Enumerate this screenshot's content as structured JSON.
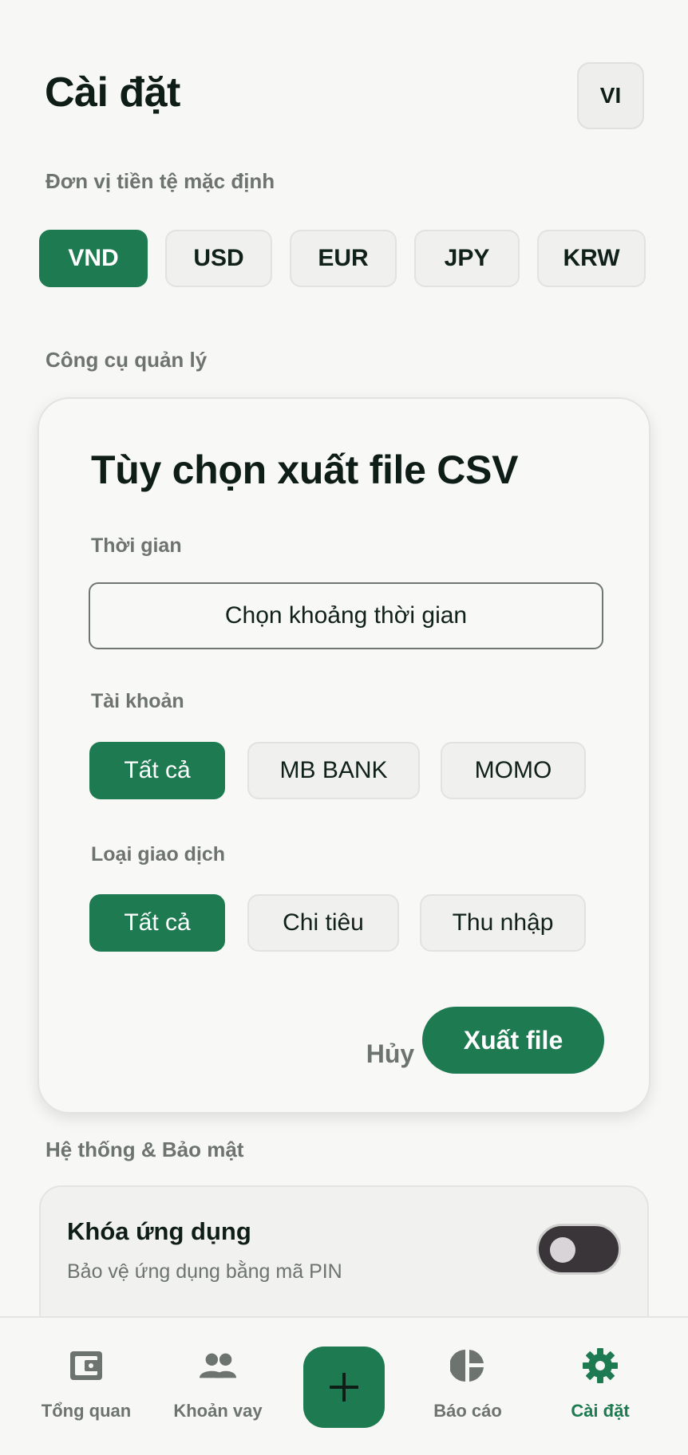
{
  "header": {
    "title": "Cài đặt",
    "language_button": "VI"
  },
  "currency": {
    "label": "Đơn vị tiền tệ mặc định",
    "options": [
      "VND",
      "USD",
      "EUR",
      "JPY",
      "KRW"
    ],
    "selected": "VND"
  },
  "tools": {
    "label": "Công cụ quản lý"
  },
  "export_dialog": {
    "title": "Tùy chọn xuất file CSV",
    "time_label": "Thời gian",
    "time_button": "Chọn khoảng thời gian",
    "account_label": "Tài khoản",
    "account_options": [
      "Tất cả",
      "MB BANK",
      "MOMO"
    ],
    "account_selected": "Tất cả",
    "type_label": "Loại giao dịch",
    "type_options": [
      "Tất cả",
      "Chi tiêu",
      "Thu nhập"
    ],
    "type_selected": "Tất cả",
    "cancel_label": "Hủy",
    "export_label": "Xuất file"
  },
  "system": {
    "label": "Hệ thống & Bảo mật",
    "app_lock_title": "Khóa ứng dụng",
    "app_lock_subtitle": "Bảo vệ ứng dụng bằng mã PIN",
    "app_lock_enabled": false
  },
  "bottom_nav": {
    "items": [
      {
        "label": "Tổng quan",
        "icon": "wallet-icon"
      },
      {
        "label": "Khoản vay",
        "icon": "people-icon"
      },
      {
        "label": "Báo cáo",
        "icon": "pie-chart-icon"
      },
      {
        "label": "Cài đặt",
        "icon": "gear-icon"
      }
    ],
    "active": "Cài đặt",
    "add_icon": "plus-icon"
  },
  "colors": {
    "accent": "#1e7a50",
    "muted_text": "#6d7470",
    "background": "#f7f7f5"
  }
}
